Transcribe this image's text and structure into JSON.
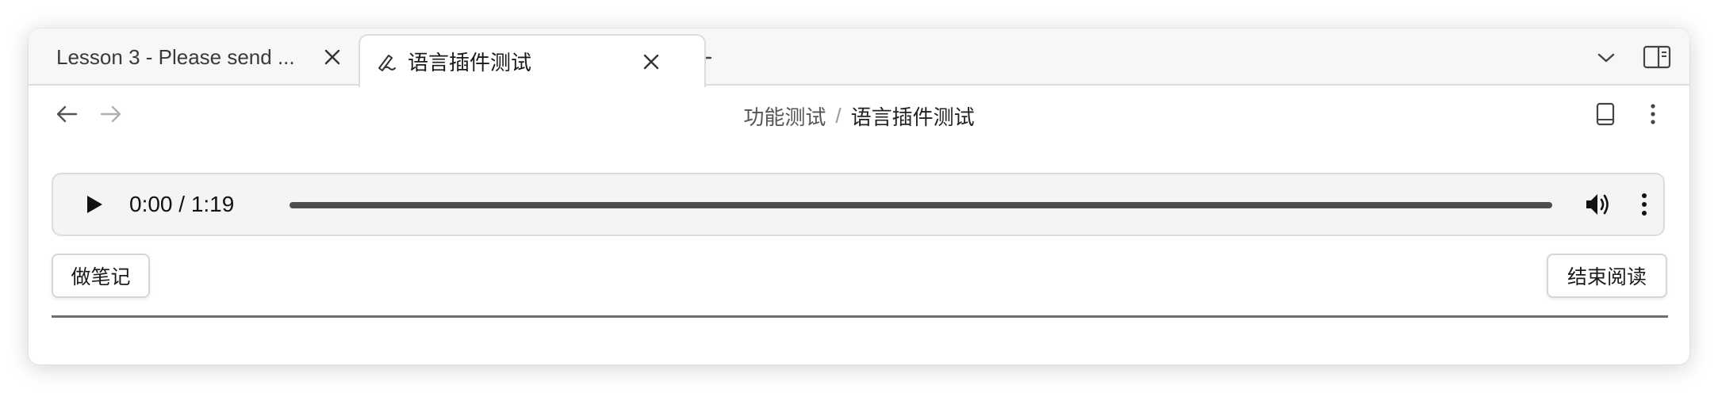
{
  "tabs": [
    {
      "title": "Lesson 3 - Please send ...",
      "icon": "none",
      "active": false
    },
    {
      "title": "语言插件测试",
      "icon": "pen-icon",
      "active": true
    }
  ],
  "breadcrumb": {
    "parent": "功能测试",
    "separator": "/",
    "current": "语言插件测试"
  },
  "audio": {
    "time": "0:00 / 1:19",
    "progress": 0
  },
  "buttons": {
    "take_note": "做笔记",
    "finish_reading": "结束阅读"
  },
  "colors": {
    "accent": "#222222",
    "tab_bar": "#f7f7f7",
    "audio_bg": "#f4f4f4",
    "divider": "#6e6e6e"
  }
}
